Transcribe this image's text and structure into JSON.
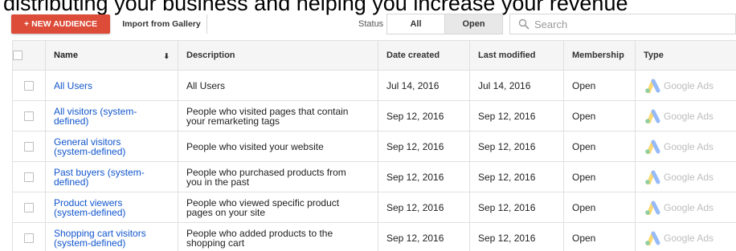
{
  "overlay_caption": "distributing your business and helping you increase your revenue",
  "toolbar": {
    "new_audience_label": "+ NEW AUDIENCE",
    "import_label": "Import from Gallery",
    "status_label": "Status",
    "status_options": [
      "All",
      "Open"
    ],
    "selected_status": "Open",
    "search_placeholder": "Search"
  },
  "table": {
    "headers": {
      "name": "Name",
      "description": "Description",
      "date_created": "Date created",
      "last_modified": "Last modified",
      "membership": "Membership",
      "type": "Type"
    },
    "rows": [
      {
        "name": [
          "All Users"
        ],
        "description": [
          "All Users"
        ],
        "date_created": "Jul 14, 2016",
        "last_modified": "Jul 14, 2016",
        "membership": "Open",
        "type": "Google Ads"
      },
      {
        "name": [
          "All visitors (system-",
          "defined)"
        ],
        "description": [
          "People who visited pages that contain",
          "your remarketing tags"
        ],
        "date_created": "Sep 12, 2016",
        "last_modified": "Sep 12, 2016",
        "membership": "Open",
        "type": "Google Ads"
      },
      {
        "name": [
          "General visitors",
          "(system-defined)"
        ],
        "description": [
          "People who visited your website"
        ],
        "date_created": "Sep 12, 2016",
        "last_modified": "Sep 12, 2016",
        "membership": "Open",
        "type": "Google Ads"
      },
      {
        "name": [
          "Past buyers (system-",
          "defined)"
        ],
        "description": [
          "People who purchased products from",
          "you in the past"
        ],
        "date_created": "Sep 12, 2016",
        "last_modified": "Sep 12, 2016",
        "membership": "Open",
        "type": "Google Ads"
      },
      {
        "name": [
          "Product viewers",
          "(system-defined)"
        ],
        "description": [
          "People who viewed specific product",
          "pages on your site"
        ],
        "date_created": "Sep 12, 2016",
        "last_modified": "Sep 12, 2016",
        "membership": "Open",
        "type": "Google Ads"
      },
      {
        "name": [
          "Shopping cart visitors",
          "(system-defined)"
        ],
        "description": [
          "People who added products to the",
          "shopping cart"
        ],
        "date_created": "Sep 12, 2016",
        "last_modified": "Sep 12, 2016",
        "membership": "Open",
        "type": "Google Ads"
      }
    ]
  },
  "colors": {
    "accent_red": "#dd4b39",
    "link_blue": "#1155cc",
    "header_bg": "#f5f5f5",
    "selected_segment_bg": "#e8e8e8"
  },
  "icons": {
    "search": "search-icon",
    "sort": "sort-arrow-icon",
    "type_logo": "google-ads-logo-icon"
  }
}
